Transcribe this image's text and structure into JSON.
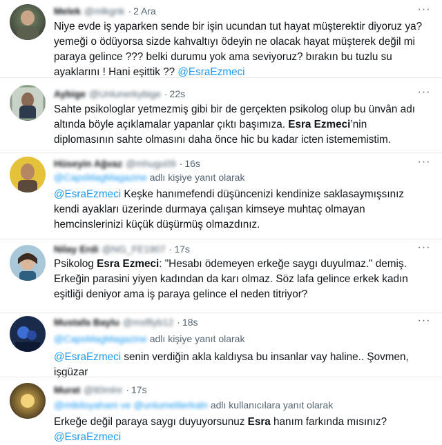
{
  "tweets": [
    {
      "name": "Melek",
      "handle": "@mlkgnk",
      "time": "2 Ara",
      "more_icon": "more-horizontal-icon",
      "body_parts": [
        {
          "t": "Niye evde iş yaparken sende bir işin ucundan tut hayat müşterektir diyoruz ya? yemeği o ödüyorsa sizde kahvaltıyı ödeyin ne olacak hayat müşterek değil mi paraya gelince ??? belki durumu yok ama seviyoruz? bırakın bu tuzlu su ayaklarını ! Hani eşittik ?? "
        },
        {
          "t": "@EsraEzmeci",
          "k": "mention"
        }
      ]
    },
    {
      "name": "Aybige",
      "handle": "@Unlunerkybige",
      "time": "22s",
      "more_icon": "more-horizontal-icon",
      "body_parts": [
        {
          "t": "Sahte psikologlar yetmezmiş gibi bir de gerçekten psikolog olup bu ünvân adı altında böyle açıklamalar yapanlar çıktı başımıza. "
        },
        {
          "t": "Esra Ezmeci",
          "k": "bold"
        },
        {
          "t": "’nin diplomasının sahte olmasını daha önce hic bu kadar icten istememistim."
        }
      ]
    },
    {
      "name": "Hüseyin Ağvaz",
      "handle": "@mhugo09",
      "time": "16s",
      "more_icon": "more-horizontal-icon",
      "reply_handle": "@CapsMagMagazine",
      "reply_suffix": "adlı kişiye yanıt olarak",
      "body_parts": [
        {
          "t": "@EsraEzmeci",
          "k": "mention"
        },
        {
          "t": " Keşke hanımefendi düşüncenizi kendinize saklasaymışsınız kendi ayakları üzerinde durmaya çalışan kimseye muhtaç olmayan hemcinslerinizi küçük düşürmüş olmazdınız."
        }
      ]
    },
    {
      "name": "Nilay Erdi",
      "handle": "@NG_FE1907",
      "time": "17s",
      "more_icon": "more-horizontal-icon",
      "body_parts": [
        {
          "t": "Psikolog "
        },
        {
          "t": "Esra Ezmeci",
          "k": "bold"
        },
        {
          "t": ": \"Hesabı ödemeyen erkeğe saygı duyulmaz.\" demiş. Erkeğin parasini yiyen kadından da karı olmaz. Söz lafa gelince erkek kadın eşitliği deniyor ama iş paraya gelince el neden titriyor?"
        }
      ]
    },
    {
      "name": "Mustafa Baylu",
      "handle": "@msfllyb12",
      "time": "18s",
      "more_icon": "more-horizontal-icon",
      "reply_handle": "@CapsMagMagazine",
      "reply_suffix": "adlı kişiye yanıt olarak",
      "body_parts": [
        {
          "t": "@EsraEzmeci",
          "k": "mention"
        },
        {
          "t": " senin verdiğin akla kaldıysa bu insanlar vay haline.. Şovmen, işgüzar"
        }
      ]
    },
    {
      "name": "Murat",
      "handle": "@lt0mlnr",
      "time": "17s",
      "more_icon": "more-horizontal-icon",
      "reply_handle": "@mtkiloyaham ve @unlumelilerkaln",
      "reply_suffix": "adlı kullanıcılara yanıt olarak",
      "body_parts": [
        {
          "t": "Erkeğe değil paraya saygı duyuyorsunuz "
        },
        {
          "t": "Esra",
          "k": "bold"
        },
        {
          "t": " hanım farkında mısınız? "
        },
        {
          "t": "@EsraEzmeci",
          "k": "mention"
        }
      ]
    }
  ],
  "colors": {
    "accent": "#1d9bf0",
    "muted": "#536471",
    "text": "#0f1419"
  }
}
